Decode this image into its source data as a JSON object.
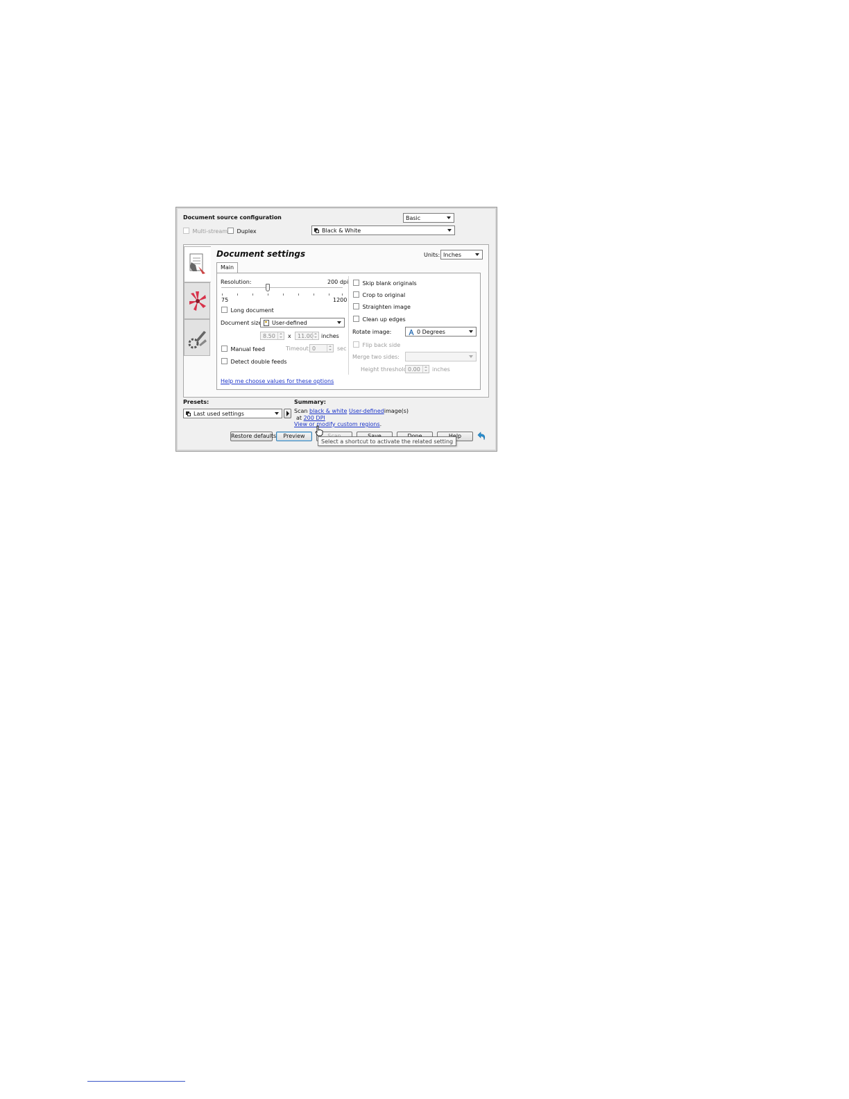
{
  "header": {
    "title": "Document source configuration",
    "mode": "Basic",
    "multistream_label": "Multi-stream",
    "duplex_label": "Duplex",
    "color_mode": "Black & White"
  },
  "settings": {
    "title": "Document settings",
    "units_label": "Units:",
    "units_value": "Inches",
    "tab_main": "Main",
    "resolution_label": "Resolution:",
    "resolution_value": "200 dpi",
    "resolution_min": "75",
    "resolution_max": "1200",
    "resolution_fraction": 0.38,
    "long_document": "Long document",
    "document_size_label": "Document size:",
    "document_size_value": "User-defined",
    "width_value": "8.50",
    "times": "x",
    "height_value": "11.00",
    "size_unit": "inches",
    "manual_feed": "Manual feed",
    "timeout_label": "Timeout:",
    "timeout_value": "0",
    "timeout_unit": "sec",
    "detect_double_feeds": "Detect double feeds",
    "skip_blank": "Skip blank originals",
    "crop_to_original": "Crop to original",
    "straighten_image": "Straighten image",
    "clean_up_edges": "Clean up edges",
    "rotate_label": "Rotate image:",
    "rotate_value": "0 Degrees",
    "flip_back_side": "Flip back side",
    "merge_label": "Merge two sides:",
    "merge_value": "",
    "height_threshold_label": "Height threshold:",
    "height_threshold_value": "0.00",
    "height_threshold_unit": "inches",
    "help_link": "Help me choose values for these options"
  },
  "presets": {
    "label": "Presets:",
    "value": "Last used settings"
  },
  "summary": {
    "label": "Summary:",
    "scan": "Scan",
    "link_color": "black & white",
    "link_size": "User-defined",
    "images": "image(s)",
    "at": "at",
    "link_dpi": "200 DPI",
    "link_regions": "View or modify custom regions",
    "period": "."
  },
  "buttons": {
    "restore_defaults": "Restore defaults",
    "preview": "Preview",
    "scan": "Scan",
    "save": "Save",
    "done": "Done",
    "help": "Help"
  },
  "tooltip": "Select a shortcut to activate the related setting",
  "colors": {
    "link": "#1a33c9",
    "back_arrow": "#2a8fd0"
  }
}
